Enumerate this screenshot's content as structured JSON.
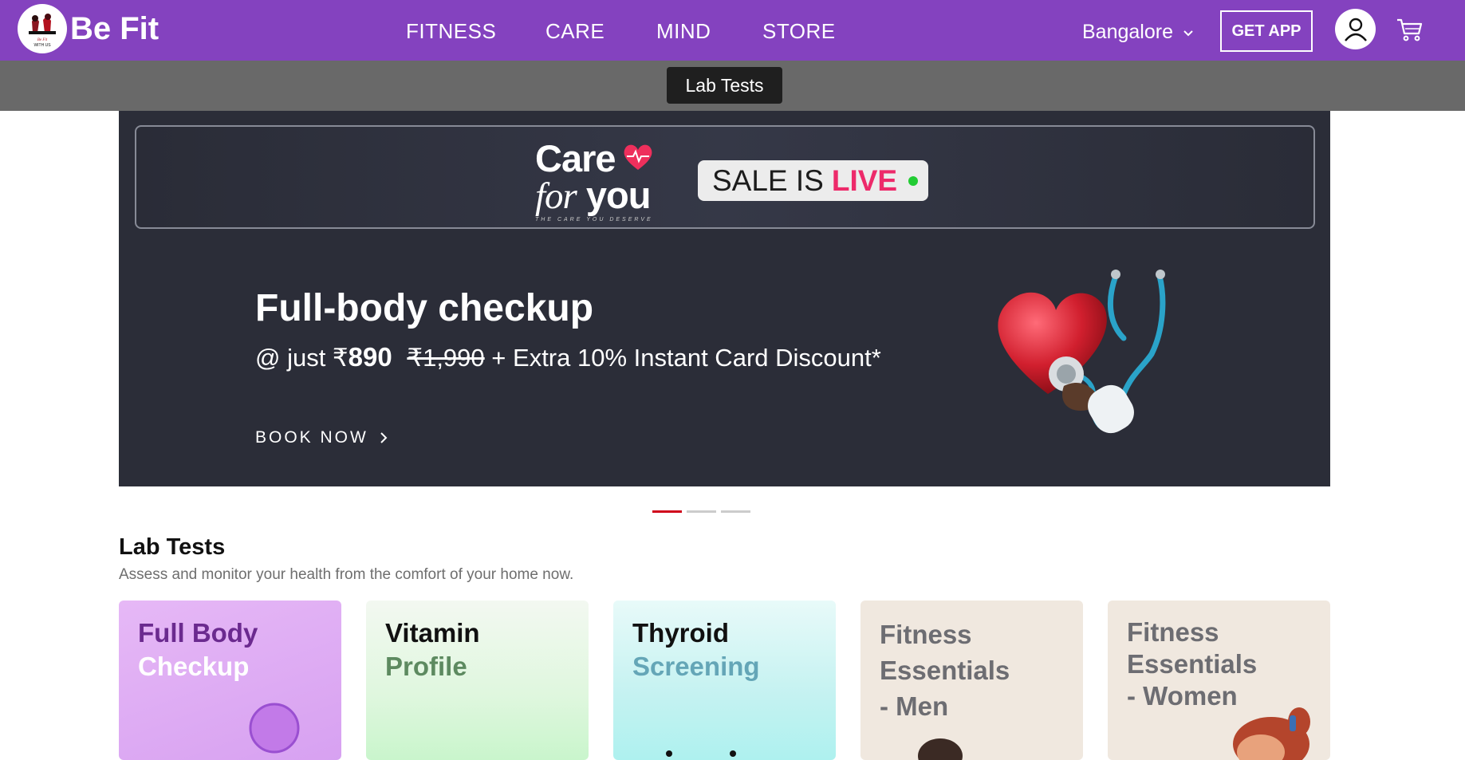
{
  "brand": {
    "name": "Be Fit",
    "logo_text": "Be Fit WITH US"
  },
  "nav": {
    "items": [
      "FITNESS",
      "CARE",
      "MIND",
      "STORE"
    ]
  },
  "header": {
    "city": "Bangalore",
    "get_app": "GET APP"
  },
  "subnav": {
    "active": "Lab Tests"
  },
  "banner": {
    "logo_line1": "Care",
    "logo_for": "for",
    "logo_you": "you",
    "logo_tagline": "THE CARE YOU DESERVE",
    "sale_text": "SALE IS",
    "sale_live": "LIVE",
    "headline": "Full-body checkup",
    "sub_prefix": "@ just ₹",
    "price": "890",
    "old_price": "₹1,990",
    "sub_suffix": "+ Extra 10% Instant Card Discount*",
    "cta": "BOOK NOW"
  },
  "carousel": {
    "count": 3,
    "active_index": 0
  },
  "section": {
    "title": "Lab Tests",
    "subtitle": "Assess and monitor your health from the comfort of your home now."
  },
  "cards": [
    {
      "line1": "Full Body",
      "line2": "Checkup"
    },
    {
      "line1": "Vitamin",
      "line2": "Profile"
    },
    {
      "line1": "Thyroid",
      "line2": "Screening"
    },
    {
      "line1": "Fitness",
      "line2": "Essentials",
      "line3": "- Men"
    },
    {
      "line1": "Fitness",
      "line2": "Essentials",
      "line3": "- Women"
    }
  ],
  "colors": {
    "nav_bg": "#8442bf",
    "subbar_bg": "#696969",
    "banner_bg": "#2b2d38",
    "accent_live": "#ed2a6a",
    "carousel_active": "#d0021b"
  },
  "icons": [
    "chevron-down-icon",
    "user-icon",
    "cart-icon",
    "chevron-right-icon",
    "heart-icon",
    "stethoscope-icon"
  ]
}
